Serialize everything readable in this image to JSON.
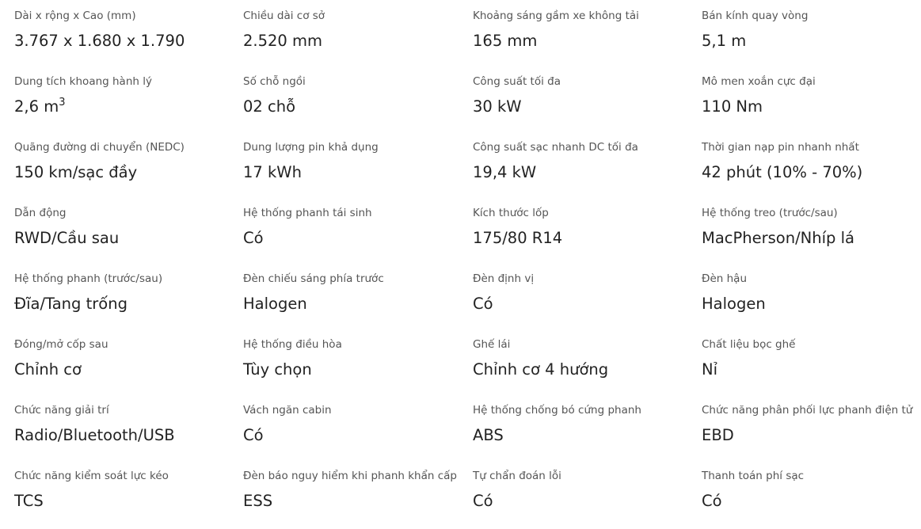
{
  "specs": [
    {
      "label": "Dài x rộng x Cao (mm)",
      "value": "3.767 x 1.680 x 1.790"
    },
    {
      "label": "Chiều dài cơ sở",
      "value": "2.520 mm"
    },
    {
      "label": "Khoảng sáng gầm xe không tải",
      "value": "165 mm"
    },
    {
      "label": "Bán kính quay vòng",
      "value": "5,1 m"
    },
    {
      "label": "Dung tích khoang hành lý",
      "value": "2,6 m",
      "value_sup": "3"
    },
    {
      "label": "Số chỗ ngồi",
      "value": "02 chỗ"
    },
    {
      "label": "Công suất tối đa",
      "value": "30 kW"
    },
    {
      "label": "Mô men xoắn cực đại",
      "value": "110 Nm"
    },
    {
      "label": "Quãng đường di chuyển (NEDC)",
      "value": "150 km/sạc đầy"
    },
    {
      "label": "Dung lượng pin khả dụng",
      "value": "17 kWh"
    },
    {
      "label": "Công suất sạc nhanh DC tối đa",
      "value": "19,4 kW"
    },
    {
      "label": "Thời gian nạp pin nhanh nhất",
      "value": "42 phút (10% - 70%)"
    },
    {
      "label": "Dẫn động",
      "value": "RWD/Cầu sau"
    },
    {
      "label": "Hệ thống phanh tái sinh",
      "value": "Có"
    },
    {
      "label": "Kích thước lốp",
      "value": "175/80 R14"
    },
    {
      "label": "Hệ thống treo (trước/sau)",
      "value": "MacPherson/Nhíp lá"
    },
    {
      "label": "Hệ thống phanh (trước/sau)",
      "value": "Đĩa/Tang trống"
    },
    {
      "label": "Đèn chiếu sáng phía trước",
      "value": "Halogen"
    },
    {
      "label": "Đèn định vị",
      "value": "Có"
    },
    {
      "label": "Đèn hậu",
      "value": "Halogen"
    },
    {
      "label": "Đóng/mở cốp sau",
      "value": "Chỉnh cơ"
    },
    {
      "label": "Hệ thống điều hòa",
      "value": "Tùy chọn"
    },
    {
      "label": "Ghế lái",
      "value": "Chỉnh cơ 4 hướng"
    },
    {
      "label": "Chất liệu bọc ghế",
      "value": "Nỉ"
    },
    {
      "label": "Chức năng giải trí",
      "value": "Radio/Bluetooth/USB"
    },
    {
      "label": "Vách ngăn cabin",
      "value": "Có"
    },
    {
      "label": "Hệ thống chống bó cứng phanh",
      "value": "ABS"
    },
    {
      "label": "Chức năng phân phối lực phanh điện tử",
      "value": "EBD"
    },
    {
      "label": "Chức năng kiểm soát lực kéo",
      "value": "TCS"
    },
    {
      "label": "Đèn báo nguy hiểm khi phanh khẩn cấp",
      "value": "ESS"
    },
    {
      "label": "Tự chẩn đoán lỗi",
      "value": "Có"
    },
    {
      "label": "Thanh toán phí sạc",
      "value": "Có"
    }
  ]
}
